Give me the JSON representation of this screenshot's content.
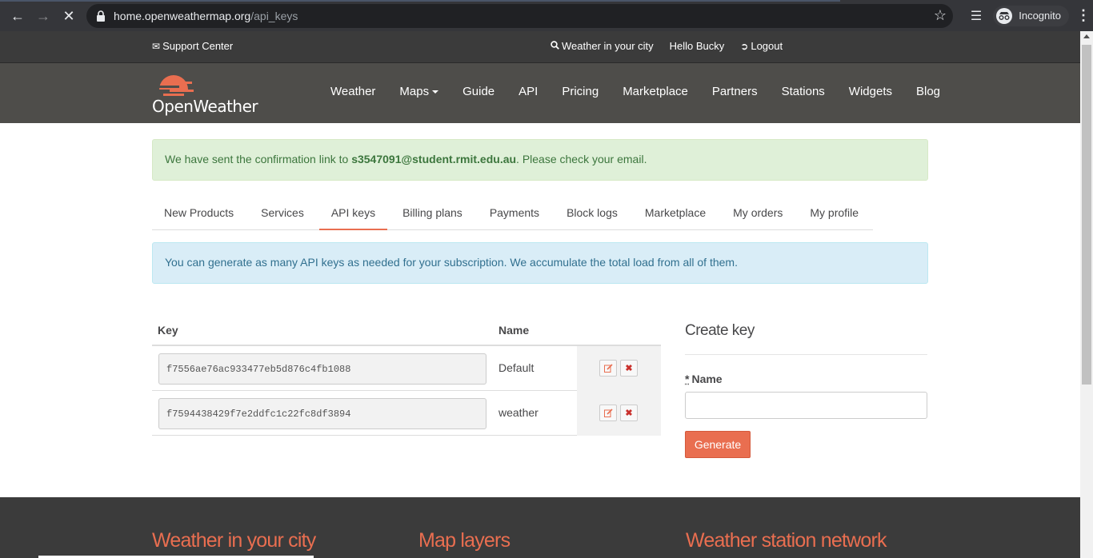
{
  "browser": {
    "url_host": "home.openweathermap.org",
    "url_path": "/api_keys",
    "profile_label": "Incognito"
  },
  "topbar": {
    "support": "Support Center",
    "weather_city": "Weather in your city",
    "greeting": "Hello Bucky",
    "logout": "Logout"
  },
  "header": {
    "logo_text": "OpenWeather",
    "nav": [
      "Weather",
      "Maps",
      "Guide",
      "API",
      "Pricing",
      "Marketplace",
      "Partners",
      "Stations",
      "Widgets",
      "Blog"
    ]
  },
  "alert_success": {
    "prefix": "We have sent the confirmation link to ",
    "email": "s3547091@student.rmit.edu.au",
    "suffix": ". Please check your email."
  },
  "tabs": [
    "New Products",
    "Services",
    "API keys",
    "Billing plans",
    "Payments",
    "Block logs",
    "Marketplace",
    "My orders",
    "My profile"
  ],
  "active_tab": "API keys",
  "alert_info": "You can generate as many API keys as needed for your subscription. We accumulate the total load from all of them.",
  "keys_table": {
    "headers": [
      "Key",
      "Name"
    ],
    "rows": [
      {
        "key": "f7556ae76ac933477eb5d876c4fb1088",
        "name": "Default"
      },
      {
        "key": "f7594438429f7e2ddfc1c22fc8df3894",
        "name": "weather"
      }
    ]
  },
  "create_key": {
    "title": "Create key",
    "required_mark": "*",
    "name_label": "Name",
    "name_value": "",
    "button": "Generate"
  },
  "footer": {
    "col1": "Weather in your city",
    "col2": "Map layers",
    "col3": "Weather station network"
  },
  "colors": {
    "accent": "#e96e50",
    "header_bg": "#4e4d4a",
    "topbar_bg": "#3b3b3b"
  }
}
